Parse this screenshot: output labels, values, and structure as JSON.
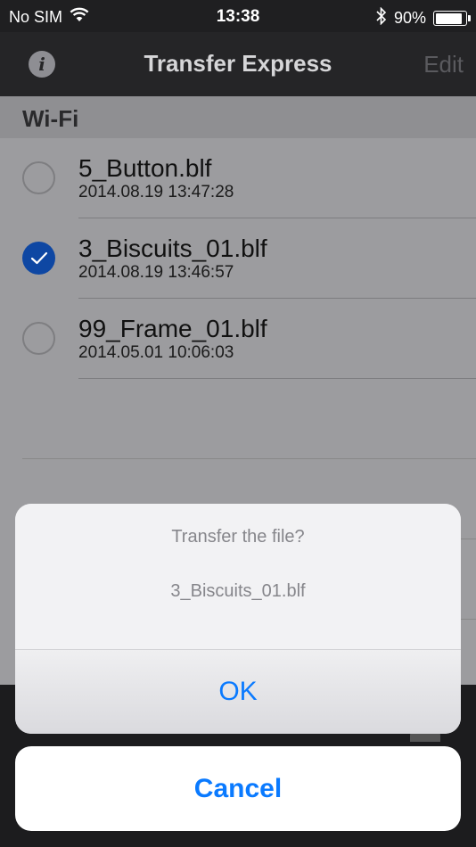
{
  "status_bar": {
    "carrier": "No SIM",
    "time": "13:38",
    "battery": "90%",
    "battery_level": 0.9
  },
  "nav": {
    "title": "Transfer Express",
    "edit_label": "Edit",
    "info_glyph": "i"
  },
  "section": {
    "title": "Wi-Fi"
  },
  "files": [
    {
      "name": "5_Button.blf",
      "date": "2014.08.19 13:47:28",
      "selected": false
    },
    {
      "name": "3_Biscuits_01.blf",
      "date": "2014.08.19 13:46:57",
      "selected": true
    },
    {
      "name": "99_Frame_01.blf",
      "date": "2014.05.01 10:06:03",
      "selected": false
    }
  ],
  "alert": {
    "title": "Transfer the file?",
    "message": "3_Biscuits_01.blf",
    "ok_label": "OK",
    "cancel_label": "Cancel"
  },
  "colors": {
    "accent": "#0a7aff",
    "selected_radio": "#0e47a3"
  }
}
